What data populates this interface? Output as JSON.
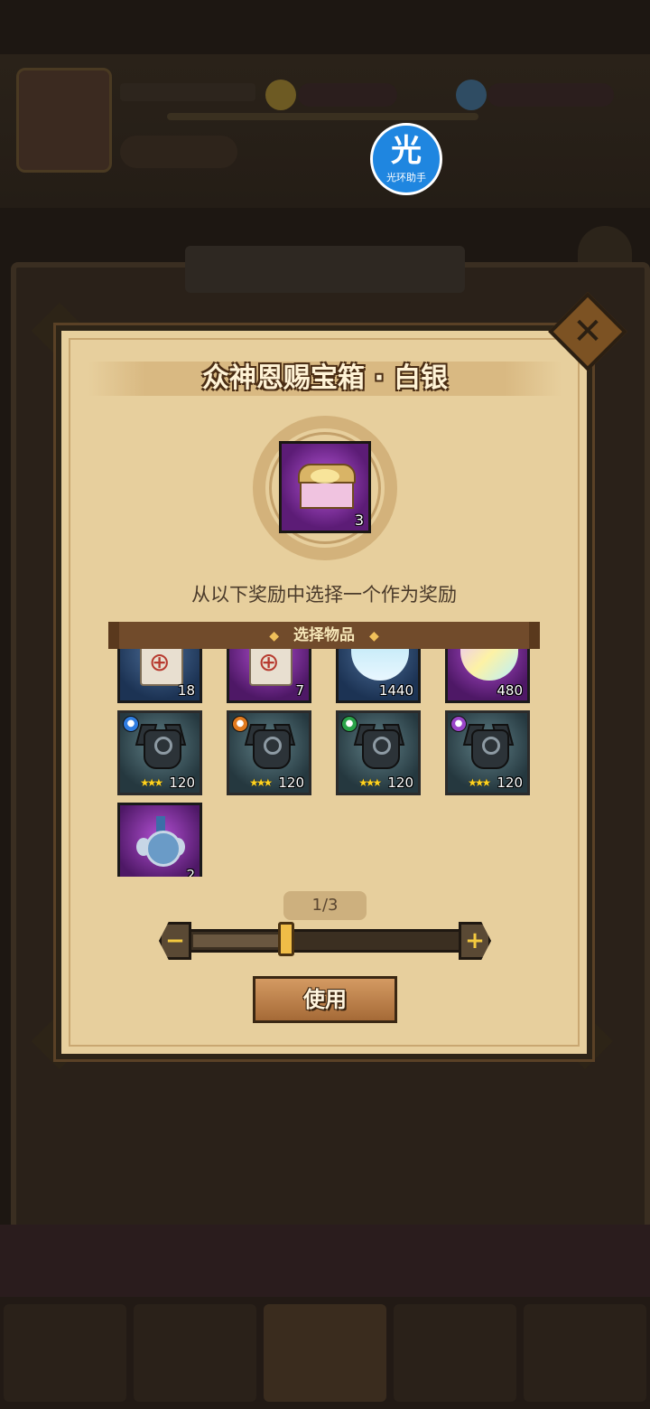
{
  "watermark": {
    "glyph": "光",
    "label": "光环助手"
  },
  "dialog": {
    "title": "众神恩赐宝箱 · 白银",
    "main_item": {
      "icon": "silver-chest",
      "count": "3"
    },
    "instruction": "从以下奖励中选择一个作为奖励",
    "section_label": "选择物品",
    "items": [
      {
        "icon": "scroll-icon",
        "count": "18",
        "rarity": "blue"
      },
      {
        "icon": "scroll-icon",
        "count": "7",
        "rarity": "purple"
      },
      {
        "icon": "crystal-icon",
        "count": "1440",
        "rarity": "blue"
      },
      {
        "icon": "crystal-icon",
        "count": "480",
        "rarity": "purple"
      },
      {
        "icon": "helmet-icon",
        "count": "120",
        "stars": "★★★",
        "type": "blue"
      },
      {
        "icon": "helmet-icon",
        "count": "120",
        "stars": "★★★",
        "type": "orange"
      },
      {
        "icon": "helmet-icon",
        "count": "120",
        "stars": "★★★",
        "type": "green"
      },
      {
        "icon": "helmet-icon",
        "count": "120",
        "stars": "★★★",
        "type": "purple"
      },
      {
        "icon": "medal-icon",
        "count": "2",
        "rarity": "purple"
      }
    ],
    "page": "1/3",
    "slider": {
      "value": 0.35,
      "minus": "−",
      "plus": "+"
    },
    "use_label": "使用",
    "close": "✕"
  },
  "colors": {
    "parchment": "#e7cf9d",
    "frame": "#2d2417",
    "accent": "#f0bd47"
  }
}
